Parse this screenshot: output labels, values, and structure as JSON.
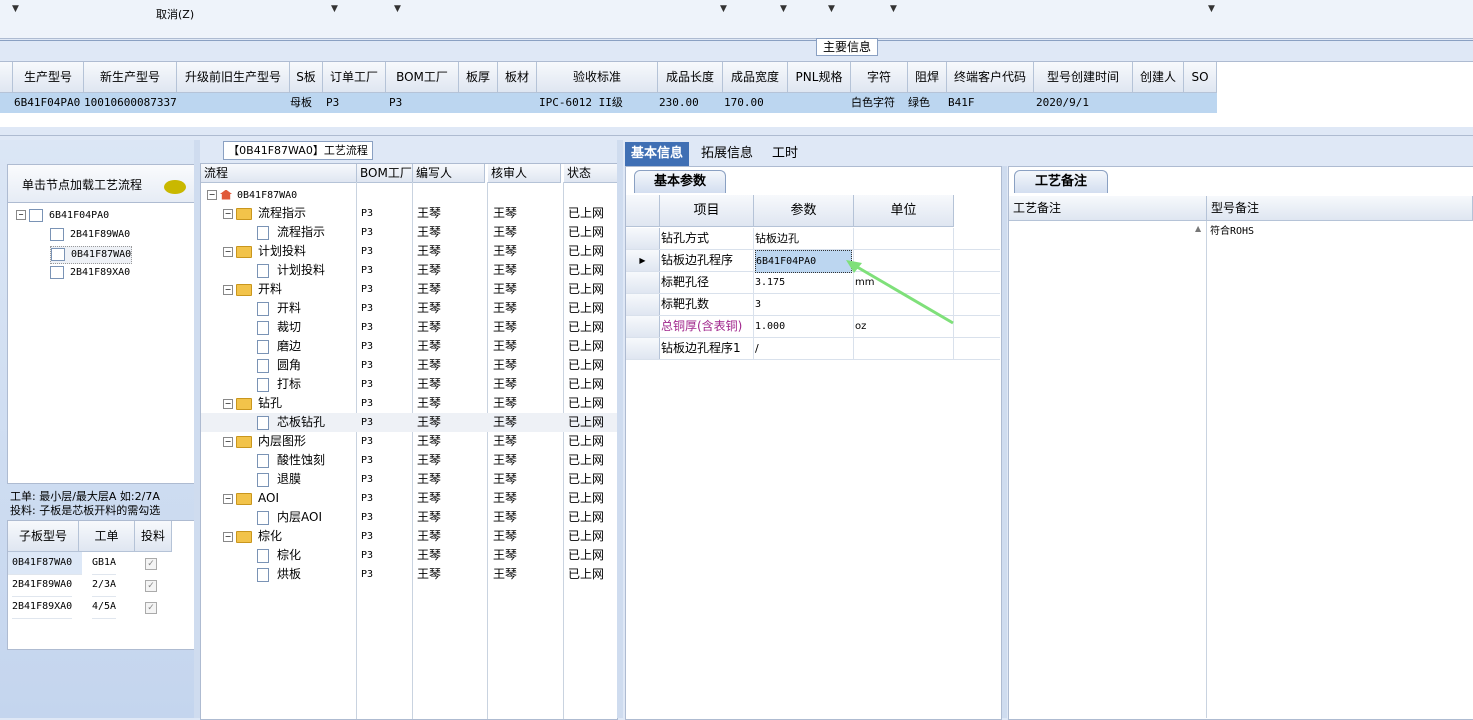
{
  "toolbar": {
    "cancel_label": "取消(Z)"
  },
  "main_info": {
    "section_label": "主要信息",
    "columns": [
      "生产型号",
      "新生产型号",
      "升级前旧生产型号",
      "S板",
      "订单工厂",
      "BOM工厂",
      "板厚",
      "板材",
      "验收标准",
      "成品长度",
      "成品宽度",
      "PNL规格",
      "字符",
      "阻焊",
      "终端客户代码",
      "型号创建时间",
      "创建人",
      "SO"
    ],
    "row": {
      "prod_model": "6B41F04PA0",
      "new_model": "10010600087337",
      "s_board": "母板",
      "order_factory": "P3",
      "bom_factory": "P3",
      "standard": "IPC-6012 II级",
      "length": "230.00",
      "width": "170.00",
      "char": "白色字符",
      "mask": "绿色",
      "customer": "B41F",
      "created": "2020/9/1"
    }
  },
  "left": {
    "load_button": "单击节点加载工艺流程",
    "tree": [
      "6B41F04PA0",
      "2B41F89WA0",
      "0B41F87WA0",
      "2B41F89XA0"
    ],
    "note_line1": "工单: 最小层/最大层A 如:2/7A",
    "note_line2": "投料: 子板是芯板开料的需勾选",
    "subgrid_headers": [
      "子板型号",
      "工单",
      "投料"
    ],
    "subgrid_rows": [
      {
        "model": "0B41F87WA0",
        "order": "GB1A",
        "check": "✓"
      },
      {
        "model": "2B41F89WA0",
        "order": "2/3A",
        "check": "✓"
      },
      {
        "model": "2B41F89XA0",
        "order": "4/5A",
        "check": "✓"
      }
    ]
  },
  "flow": {
    "title": "【0B41F87WA0】工艺流程",
    "headers": [
      "流程",
      "BOM工厂",
      "编写人",
      "核审人",
      "状态"
    ],
    "root": "0B41F87WA0",
    "rows": [
      {
        "name": "流程指示",
        "level": 1,
        "bom": "P3",
        "writer": "王琴",
        "reviewer": "王琴",
        "status": "已上网"
      },
      {
        "name": "流程指示",
        "level": 2,
        "bom": "P3",
        "writer": "王琴",
        "reviewer": "王琴",
        "status": "已上网"
      },
      {
        "name": "计划投料",
        "level": 1,
        "bom": "P3",
        "writer": "王琴",
        "reviewer": "王琴",
        "status": "已上网"
      },
      {
        "name": "计划投料",
        "level": 2,
        "bom": "P3",
        "writer": "王琴",
        "reviewer": "王琴",
        "status": "已上网"
      },
      {
        "name": "开料",
        "level": 1,
        "bom": "P3",
        "writer": "王琴",
        "reviewer": "王琴",
        "status": "已上网"
      },
      {
        "name": "开料",
        "level": 2,
        "bom": "P3",
        "writer": "王琴",
        "reviewer": "王琴",
        "status": "已上网"
      },
      {
        "name": "裁切",
        "level": 2,
        "bom": "P3",
        "writer": "王琴",
        "reviewer": "王琴",
        "status": "已上网"
      },
      {
        "name": "磨边",
        "level": 2,
        "bom": "P3",
        "writer": "王琴",
        "reviewer": "王琴",
        "status": "已上网"
      },
      {
        "name": "圆角",
        "level": 2,
        "bom": "P3",
        "writer": "王琴",
        "reviewer": "王琴",
        "status": "已上网"
      },
      {
        "name": "打标",
        "level": 2,
        "bom": "P3",
        "writer": "王琴",
        "reviewer": "王琴",
        "status": "已上网"
      },
      {
        "name": "钻孔",
        "level": 1,
        "bom": "P3",
        "writer": "王琴",
        "reviewer": "王琴",
        "status": "已上网"
      },
      {
        "name": "芯板钻孔",
        "level": 2,
        "bom": "P3",
        "writer": "王琴",
        "reviewer": "王琴",
        "status": "已上网",
        "selected": true
      },
      {
        "name": "内层图形",
        "level": 1,
        "bom": "P3",
        "writer": "王琴",
        "reviewer": "王琴",
        "status": "已上网"
      },
      {
        "name": "酸性蚀刻",
        "level": 2,
        "bom": "P3",
        "writer": "王琴",
        "reviewer": "王琴",
        "status": "已上网"
      },
      {
        "name": "退膜",
        "level": 2,
        "bom": "P3",
        "writer": "王琴",
        "reviewer": "王琴",
        "status": "已上网"
      },
      {
        "name": "AOI",
        "level": 1,
        "bom": "P3",
        "writer": "王琴",
        "reviewer": "王琴",
        "status": "已上网"
      },
      {
        "name": "内层AOI",
        "level": 2,
        "bom": "P3",
        "writer": "王琴",
        "reviewer": "王琴",
        "status": "已上网"
      },
      {
        "name": "棕化",
        "level": 1,
        "bom": "P3",
        "writer": "王琴",
        "reviewer": "王琴",
        "status": "已上网"
      },
      {
        "name": "棕化",
        "level": 2,
        "bom": "P3",
        "writer": "王琴",
        "reviewer": "王琴",
        "status": "已上网"
      },
      {
        "name": "烘板",
        "level": 2,
        "bom": "P3",
        "writer": "王琴",
        "reviewer": "王琴",
        "status": "已上网"
      }
    ]
  },
  "tabs": [
    "基本信息",
    "拓展信息",
    "工时"
  ],
  "basic": {
    "panel_tab": "基本参数",
    "headers": [
      "项目",
      "参数",
      "单位"
    ],
    "rows": [
      {
        "item": "钻孔方式",
        "value": "钻板边孔",
        "unit": ""
      },
      {
        "item": "钻板边孔程序",
        "value": "6B41F04PA0",
        "unit": ""
      },
      {
        "item": "标靶孔径",
        "value": "3.175",
        "unit": "mm"
      },
      {
        "item": "标靶孔数",
        "value": "3",
        "unit": ""
      },
      {
        "item": "总铜厚(含表铜)",
        "value": "1.000",
        "unit": "oz"
      },
      {
        "item": "钻板边孔程序1",
        "value": "/",
        "unit": ""
      }
    ]
  },
  "remarks": {
    "panel_tab": "工艺备注",
    "headers": [
      "工艺备注",
      "型号备注"
    ],
    "model_remark": "符合ROHS"
  },
  "colors": {
    "accent": "#3f6fb4",
    "selected_row": "#bcd6f0",
    "arrow": "#7fe07a"
  }
}
